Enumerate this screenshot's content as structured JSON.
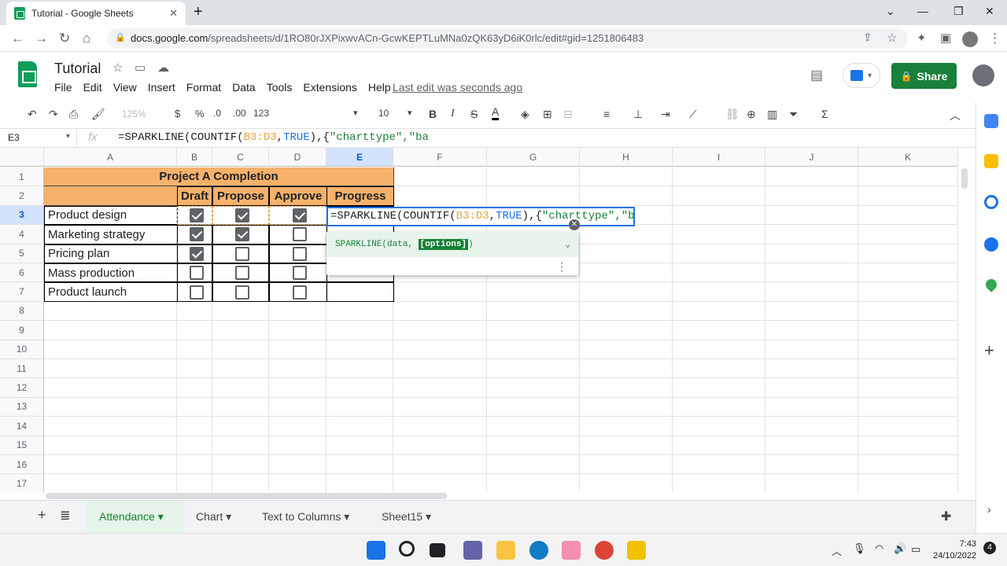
{
  "browser": {
    "tab_title": "Tutorial - Google Sheets",
    "url_host": "docs.google.com",
    "url_path": "/spreadsheets/d/1RO80rJXPixwvACn-GcwKEPTLuMNa0zQK63yD6iK0rlc/edit#gid=1251806483"
  },
  "doc": {
    "title": "Tutorial",
    "menus": [
      "File",
      "Edit",
      "View",
      "Insert",
      "Format",
      "Data",
      "Tools",
      "Extensions",
      "Help"
    ],
    "last_edit": "Last edit was seconds ago",
    "share_label": "Share"
  },
  "toolbar": {
    "zoom": "125%",
    "currency": "$",
    "percent": "%",
    "dec_less": ".0",
    "dec_more": ".00",
    "format_num": "123",
    "font_size": "10"
  },
  "formula_bar": {
    "cell_ref": "E3",
    "formula_prefix": "=SPARKLINE(COUNTIF(",
    "formula_range": "B3:D3",
    "formula_comma": ",",
    "formula_kw": "TRUE",
    "formula_rest1": "),{",
    "formula_str": "\"charttype\"",
    "formula_rest2": ",\"ba"
  },
  "grid": {
    "columns": [
      "A",
      "B",
      "C",
      "D",
      "E",
      "F",
      "G",
      "H",
      "I",
      "J",
      "K"
    ],
    "rows": [
      "1",
      "2",
      "3",
      "4",
      "5",
      "6",
      "7",
      "8",
      "9",
      "10",
      "11",
      "12",
      "13",
      "14",
      "15",
      "16",
      "17"
    ],
    "title": "Project A Completion",
    "headers": [
      "Draft",
      "Propose",
      "Approve",
      "Progress"
    ],
    "tasks": [
      {
        "name": "Product design",
        "checks": [
          true,
          true,
          true
        ]
      },
      {
        "name": "Marketing strategy",
        "checks": [
          true,
          true,
          false
        ]
      },
      {
        "name": "Pricing plan",
        "checks": [
          true,
          false,
          false
        ]
      },
      {
        "name": "Mass production",
        "checks": [
          false,
          false,
          false
        ]
      },
      {
        "name": "Product launch",
        "checks": [
          false,
          false,
          false
        ]
      }
    ]
  },
  "autocomplete": {
    "fn": "SPARKLINE(data, ",
    "opt": "[options]",
    "close": ")"
  },
  "sheet_tabs": [
    "Attendance",
    "Chart",
    "Text to Columns",
    "Sheet15"
  ],
  "clock": {
    "time": "7:43",
    "date": "24/10/2022"
  },
  "colors": {
    "accent": "#188038",
    "header_fill": "#f6b26b",
    "select": "#1a73e8"
  }
}
